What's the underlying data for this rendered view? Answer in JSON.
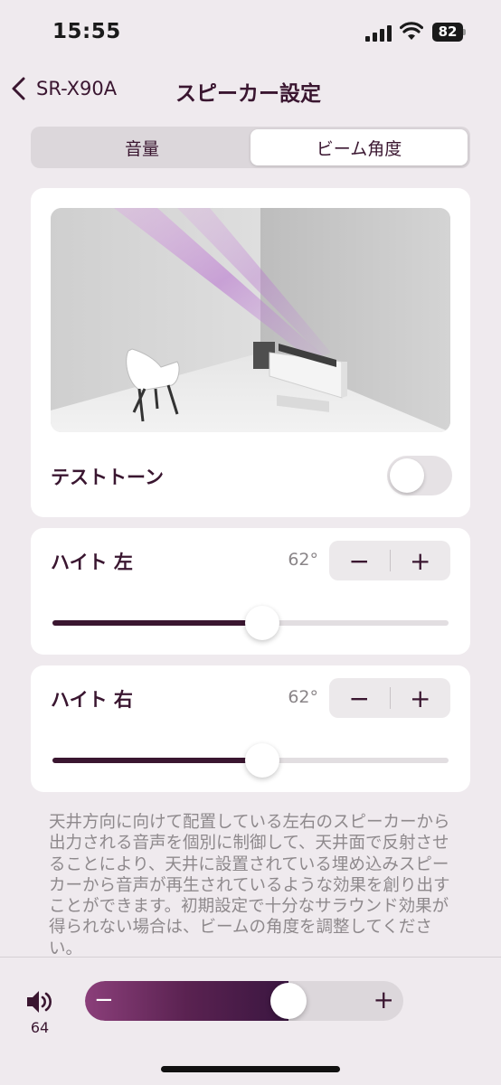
{
  "status_bar": {
    "time": "15:55",
    "battery": "82",
    "icons": [
      "signal-icon",
      "wifi-icon",
      "battery-icon"
    ]
  },
  "nav": {
    "back_label": "SR-X90A",
    "title": "スピーカー設定",
    "back_icon": "chevron-left-icon"
  },
  "segment": {
    "tabs": [
      {
        "label": "音量",
        "active": false
      },
      {
        "label": "ビーム角度",
        "active": true
      }
    ]
  },
  "test_tone": {
    "label": "テストトーン",
    "enabled": false
  },
  "height_left": {
    "title": "ハイト 左",
    "angle": "62°",
    "minus": "−",
    "plus": "+",
    "level": 0.53
  },
  "height_right": {
    "title": "ハイト 右",
    "angle": "62°",
    "minus": "−",
    "plus": "+",
    "level": 0.53
  },
  "description": "天井方向に向けて配置している左右のスピーカーから出力される音声を個別に制御して、天井面で反射させることにより、天井に設置されている埋め込みスピーカーから音声が再生されているような効果を創り出すことができます。初期設定で十分なサラウンド効果が得られない場合は、ビームの角度を調整してください。",
  "volume": {
    "value": "64",
    "minus": "−",
    "plus": "+",
    "level": 0.64,
    "icon": "speaker-volume-icon"
  },
  "colors": {
    "accent": "#3a1630",
    "background": "#efeaee",
    "card": "#ffffff",
    "beam": "#c98fe0"
  }
}
